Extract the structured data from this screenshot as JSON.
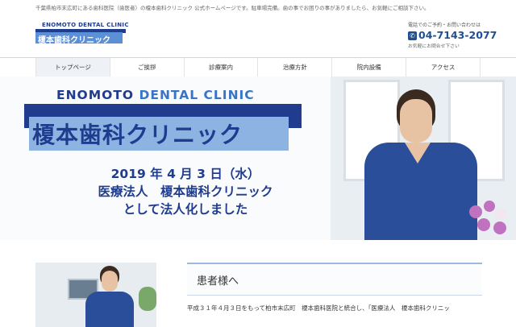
{
  "topbar": {
    "message": "千葉県柏市末広町にある歯科医院（歯医者）の榎本歯科クリニック 公式ホームページです。駐車場完備。歯の事でお困りの事がありましたら、お気軽にご相談下さい。"
  },
  "header": {
    "logo": {
      "en": "ENOMOTO DENTAL CLINIC",
      "jp": "榎本歯科クリニック"
    },
    "contact": {
      "label": "電話でのご予約・お問い合わせは",
      "phone": "04-7143-2077",
      "note": "お気軽にお問合せ下さい"
    }
  },
  "nav": {
    "items": [
      {
        "label": "トップページ"
      },
      {
        "label": "ご挨拶"
      },
      {
        "label": "診療案内"
      },
      {
        "label": "治療方針"
      },
      {
        "label": "院内設備"
      },
      {
        "label": "アクセス"
      }
    ]
  },
  "hero": {
    "en_title_1": "ENOMOTO ",
    "en_title_2": "DENTAL CLINIC",
    "jp_title": "榎本歯科クリニック",
    "announcement": [
      "2019 年 4 月 3 日（水）",
      "医療法人　榎本歯科クリニック",
      "として法人化しました"
    ]
  },
  "notice": {
    "title": "患者様へ",
    "body": "平成３１年４月３日をもって柏市末広町　榎本歯科医院と統合し、「医療法人　榎本歯科クリニッ"
  },
  "icons": {
    "phone": "phone-icon"
  },
  "colors": {
    "brand_dark": "#1f3c8f",
    "brand_light": "#8cb3e2",
    "accent_blue": "#3a74c6"
  }
}
